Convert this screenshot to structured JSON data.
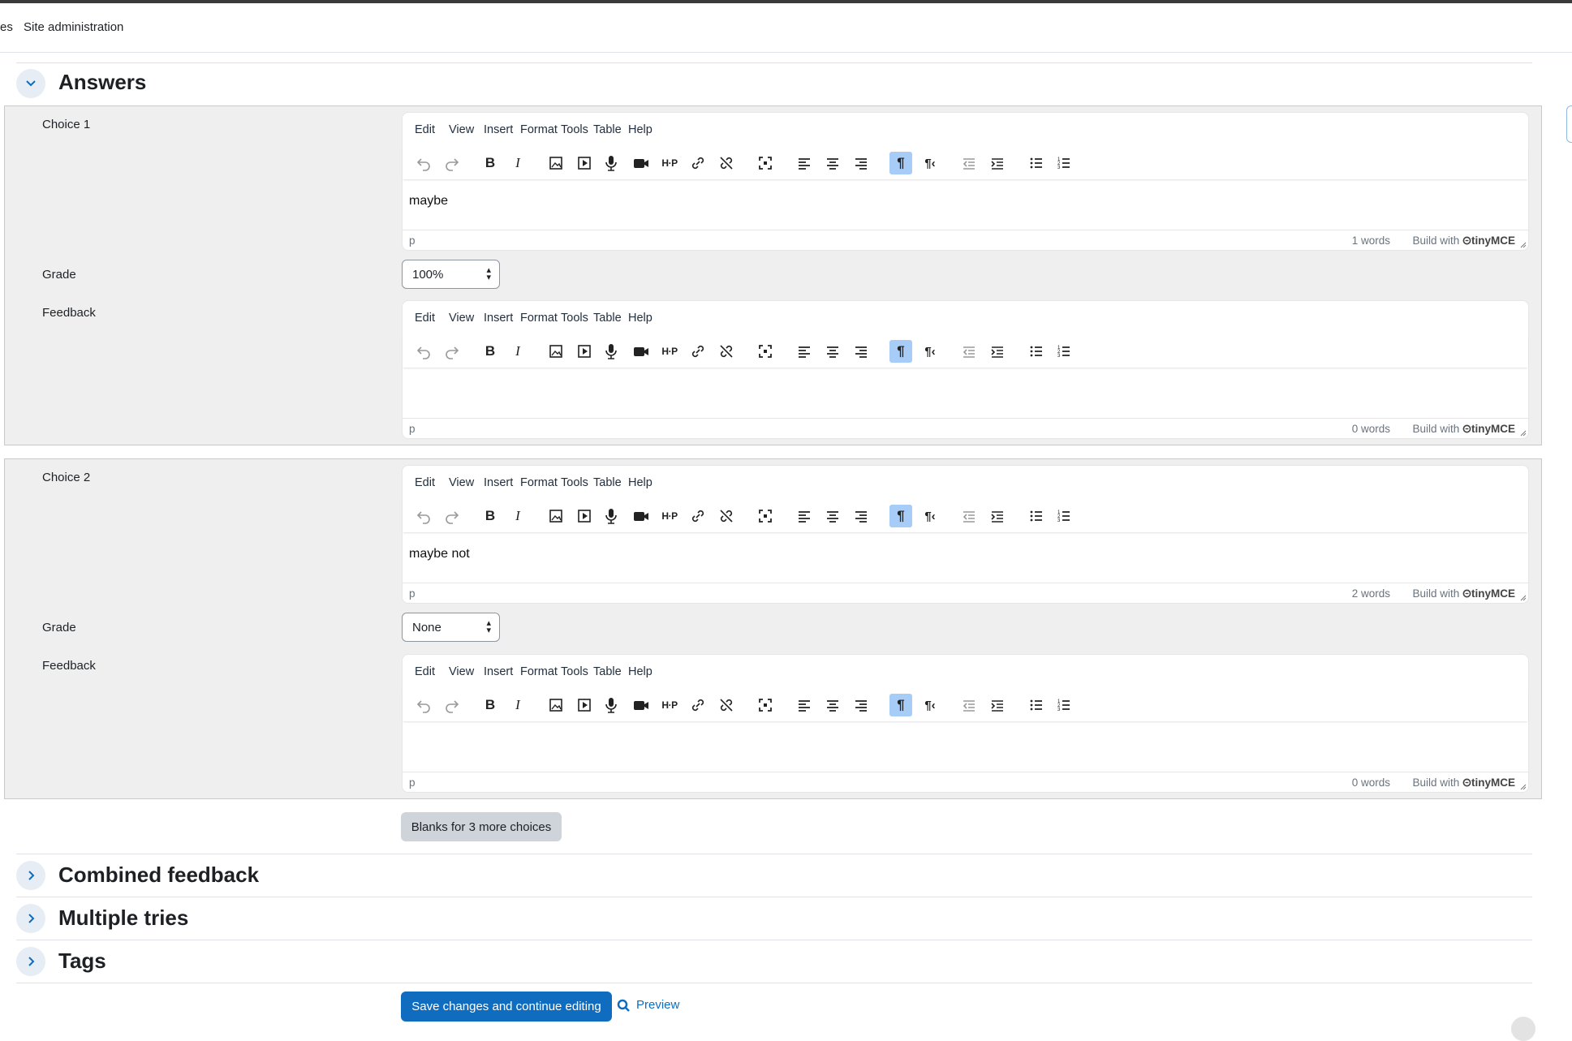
{
  "nav": {
    "partial": "es",
    "site_admin": "Site administration"
  },
  "sections": {
    "answers": "Answers",
    "combined_feedback": "Combined feedback",
    "multiple_tries": "Multiple tries",
    "tags": "Tags"
  },
  "editor_menu": [
    "Edit",
    "View",
    "Insert",
    "Format",
    "Tools",
    "Table",
    "Help"
  ],
  "editor_status": {
    "path": "p",
    "build_with": "Build with",
    "brand": "tinyMCE"
  },
  "choices": [
    {
      "label": "Choice 1",
      "content": "maybe",
      "words": "1 words",
      "grade_label": "Grade",
      "grade": "100%",
      "feedback_label": "Feedback",
      "feedback_words": "0 words"
    },
    {
      "label": "Choice 2",
      "content": "maybe not",
      "words": "2 words",
      "grade_label": "Grade",
      "grade": "None",
      "feedback_label": "Feedback",
      "feedback_words": "0 words"
    }
  ],
  "buttons": {
    "blanks": "Blanks for 3 more choices",
    "save": "Save changes and continue editing",
    "preview": "Preview"
  },
  "colors": {
    "primary": "#0f6cbf",
    "active_tool": "#a6ccf7",
    "fieldset_bg": "#efefef"
  }
}
